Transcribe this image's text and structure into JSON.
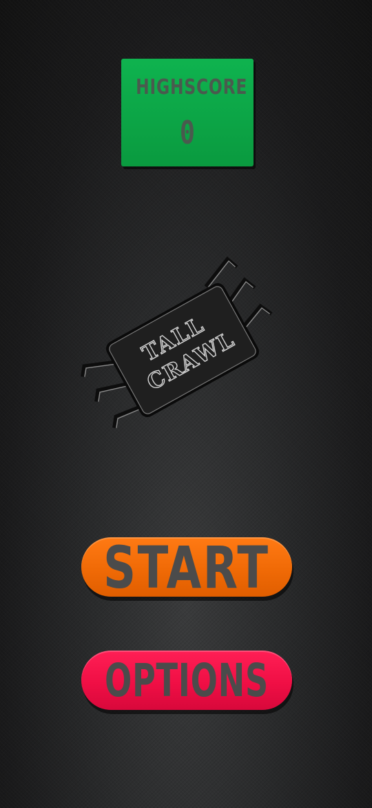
{
  "highscore": {
    "label": "HIGHSCORE",
    "value": "0"
  },
  "logo": {
    "line1": "TALL",
    "line2": "CRAWL",
    "icon": "spider-chip-icon"
  },
  "menu": {
    "start_label": "START",
    "options_label": "OPTIONS"
  },
  "colors": {
    "highscore_panel": "#0fb34f",
    "start_button": "#f06a06",
    "options_button": "#f00f45",
    "label_text": "#4b4b4b",
    "background": "#222324"
  }
}
